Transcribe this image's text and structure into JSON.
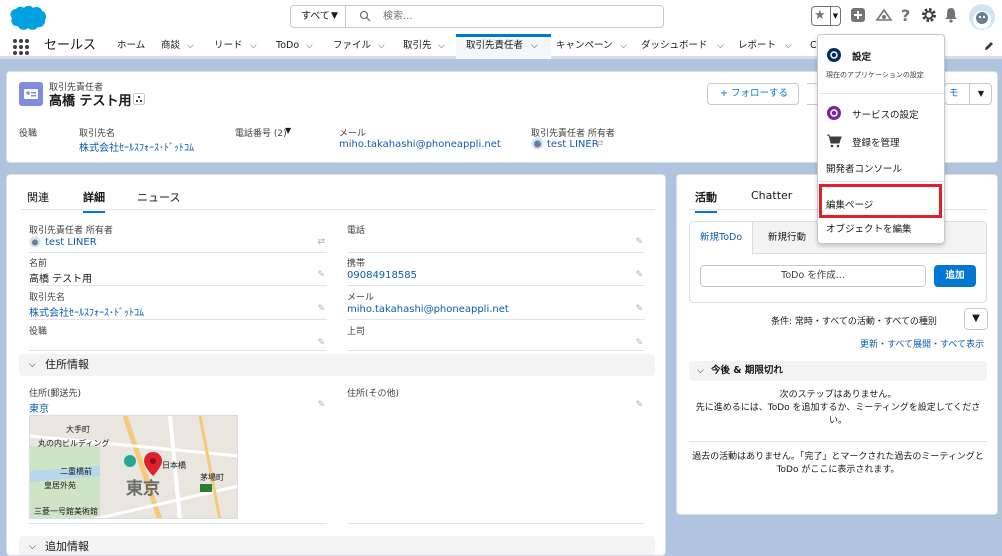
{
  "header": {
    "search": {
      "scope": "すべて",
      "placeholder": "検索..."
    }
  },
  "nav": {
    "app_name": "セールス",
    "tabs": [
      "ホーム",
      "商談",
      "リード",
      "ToDo",
      "ファイル",
      "取引先",
      "取引先責任者",
      "キャンペーン",
      "ダッシュボード",
      "レポート",
      "C"
    ]
  },
  "record": {
    "object_label": "取引先責任者",
    "name": "高橋 テスト用",
    "follow_label": "+ フォローする",
    "memo_label": "モ",
    "fields": {
      "title_label": "役職",
      "account_label": "取引先名",
      "account_value": "株式会社ｾｰﾙｽﾌｫｰｽ･ﾄﾞｯﾄｺﾑ",
      "phone_label": "電話番号 (2)",
      "email_label": "メール",
      "email_value": "miho.takahashi@phoneappli.net",
      "owner_label": "取引先責任者 所有者",
      "owner_value": "test LINER"
    }
  },
  "detail": {
    "tabs": [
      "関連",
      "詳細",
      "ニュース"
    ],
    "fields": [
      {
        "label": "取引先責任者 所有者",
        "value": "test LINER"
      },
      {
        "label": "電話",
        "value": ""
      },
      {
        "label": "名前",
        "value": "高橋 テスト用"
      },
      {
        "label": "携帯",
        "value": "09084918585"
      },
      {
        "label": "取引先名",
        "value": "株式会社ｾｰﾙｽﾌｫｰｽ･ﾄﾞｯﾄｺﾑ"
      },
      {
        "label": "メール",
        "value": "miho.takahashi@phoneappli.net"
      },
      {
        "label": "役職",
        "value": ""
      },
      {
        "label": "上司",
        "value": ""
      }
    ],
    "address_section": "住所情報",
    "mailing_label": "住所(郵送先)",
    "mailing_value": "東京",
    "other_label": "住所(その他)",
    "map_labels": [
      "大手町",
      "丸の内ビルディング",
      "二重橋前",
      "皇居外苑",
      "日本橋",
      "東京",
      "茅場町",
      "三菱一号館美術館"
    ],
    "additional_section": "追加情報"
  },
  "activity": {
    "tabs": [
      "活動",
      "Chatter"
    ],
    "inner_tabs": [
      "新規ToDo",
      "新規行動"
    ],
    "todo_placeholder": "ToDo を作成...",
    "add_label": "追加",
    "condition": "条件: 常時・すべての活動・すべての種別",
    "links": "更新・すべて展開・すべて表示",
    "upcoming": "今後 & 期限切れ",
    "no_steps_1": "次のステップはありません。",
    "no_steps_2": "先に進めるには、ToDo を追加するか、ミーティングを設定してください。",
    "past": "過去の活動はありません。「完了」とマークされた過去のミーティングと ToDo がここに表示されます。"
  },
  "menu": {
    "settings": "設定",
    "settings_sub": "現在のアプリケーションの設定",
    "service_setup": "サービスの設定",
    "manage_subs": "登録を管理",
    "dev_console": "開発者コンソール",
    "edit_page": "編集ページ",
    "edit_object": "オブジェクトを編集"
  },
  "colors": {
    "brand": "#0176d3",
    "highlight": "#e0202a",
    "background": "#b0c4df"
  }
}
